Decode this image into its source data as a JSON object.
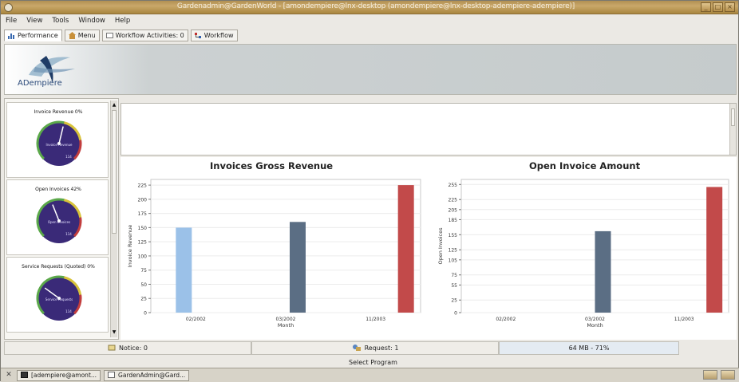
{
  "window": {
    "title": "Gardenadmin@GardenWorld - [amondempiere@lnx-desktop (amondempiere@lnx-desktop-adempiere-adempiere)]"
  },
  "menu": [
    "File",
    "View",
    "Tools",
    "Window",
    "Help"
  ],
  "tabs": [
    {
      "label": "Performance",
      "icon": "chart-icon"
    },
    {
      "label": "Menu",
      "icon": "home-icon"
    },
    {
      "label": "Workflow Activities: 0",
      "icon": "workflow-activity-icon"
    },
    {
      "label": "Workflow",
      "icon": "workflow-icon"
    }
  ],
  "banner": {
    "logo_text": "ADempiere"
  },
  "gauges": [
    {
      "title": "Invoice Revenue 0%",
      "needle_pct": 0.55,
      "label": "Invoice Revenue",
      "value": "114"
    },
    {
      "title": "Open Invoices 42%",
      "needle_pct": 0.42,
      "label": "Open Invoices",
      "value": "114"
    },
    {
      "title": "Service Requests (Quoted) 0%",
      "needle_pct": 0.3,
      "label": "Service Requests",
      "value": "114"
    }
  ],
  "colors": {
    "gauge_face": "#3a2a78",
    "gauge_rim_green": "#5ba84a",
    "gauge_rim_yellow": "#d8c33a",
    "gauge_rim_red": "#c23d3d",
    "bar_light_blue": "#9bc1e8",
    "bar_slate": "#5b6e84",
    "bar_red": "#c24a4a"
  },
  "chart_data": [
    {
      "type": "bar",
      "title": "Invoices Gross Revenue",
      "xlabel": "Month",
      "ylabel": "Invoice Revenue",
      "categories": [
        "02/2002",
        "03/2002",
        "11/2003"
      ],
      "values": [
        150,
        160,
        225
      ],
      "colors": [
        "#9bc1e8",
        "#5b6e84",
        "#c24a4a"
      ],
      "yticks": [
        0,
        25,
        50,
        75,
        100,
        125,
        150,
        175,
        200,
        225
      ],
      "ylim": [
        0,
        235
      ]
    },
    {
      "type": "bar",
      "title": "Open Invoice Amount",
      "xlabel": "Month",
      "ylabel": "Open Invoices",
      "categories": [
        "02/2002",
        "03/2002",
        "11/2003"
      ],
      "values": [
        0,
        162,
        250
      ],
      "colors": [
        "#9bc1e8",
        "#5b6e84",
        "#c24a4a"
      ],
      "yticks": [
        0,
        25,
        55,
        75,
        105,
        125,
        155,
        185,
        205,
        225,
        255
      ],
      "ylim": [
        0,
        265
      ]
    }
  ],
  "status": {
    "notice": "Notice: 0",
    "request": "Request: 1",
    "memory": "64 MB - 71%",
    "select_program": "Select Program"
  },
  "taskbar": [
    "[adempiere@amont...",
    "GardenAdmin@Gard..."
  ]
}
